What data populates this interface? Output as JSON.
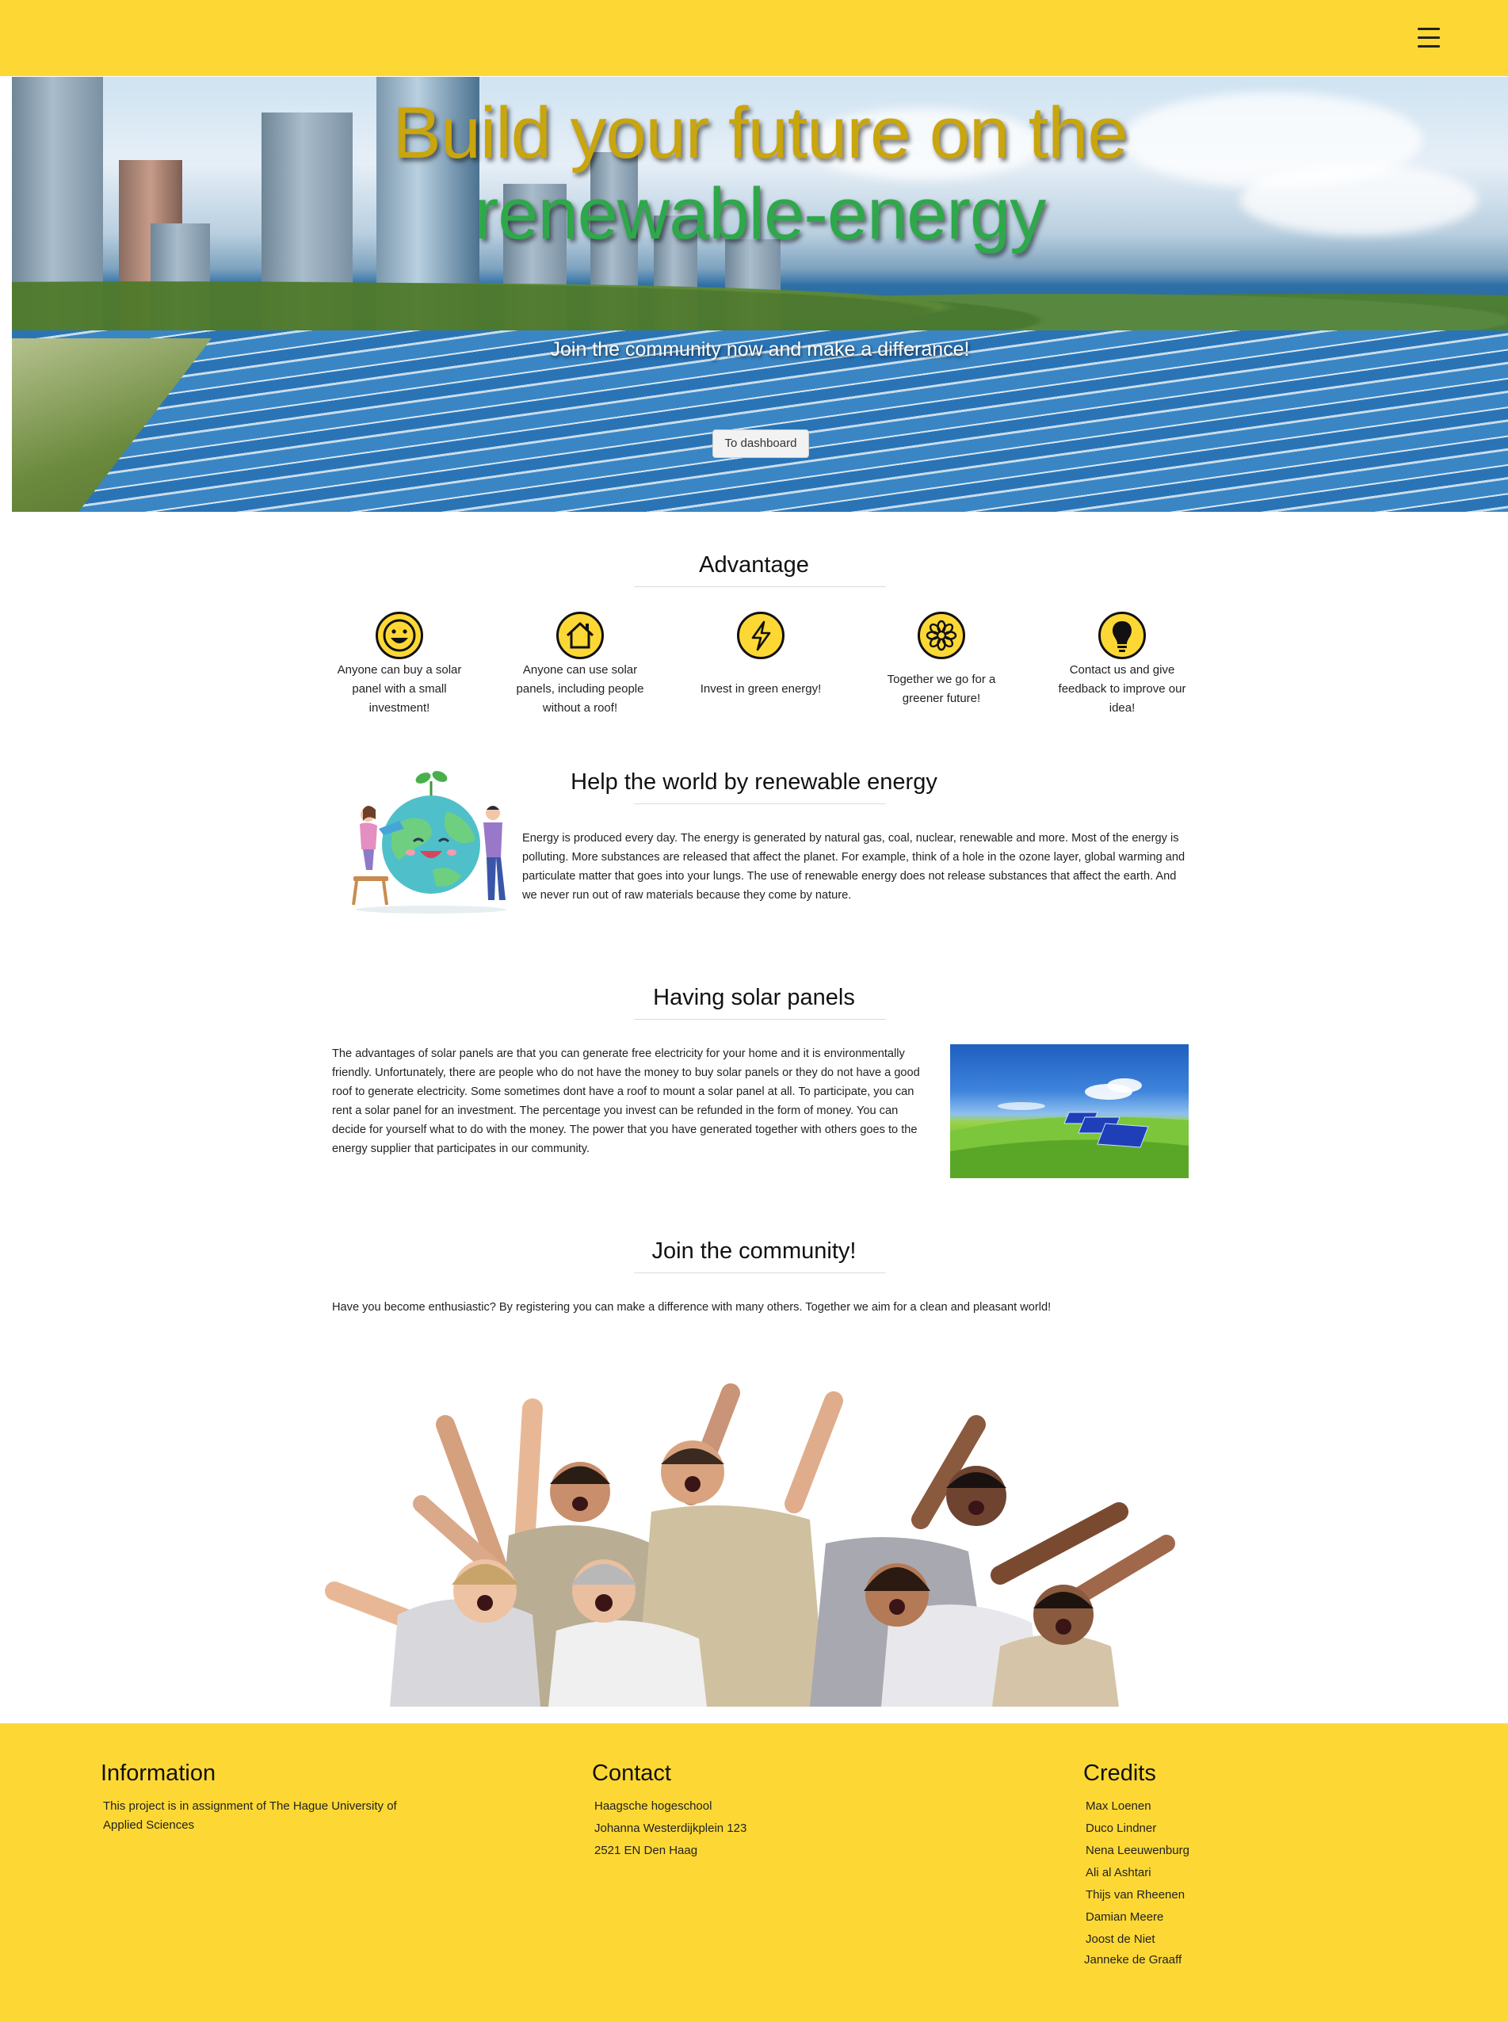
{
  "hero": {
    "title_line1": "Build your future on the",
    "title_line2": "renewable-energy",
    "subtitle": "Join the community now and make a differance!",
    "button": "To dashboard"
  },
  "advantage": {
    "title": "Advantage",
    "items": [
      {
        "icon": "smile-icon",
        "text": "Anyone can buy a solar panel with a small investment!"
      },
      {
        "icon": "house-icon",
        "text": "Anyone can use solar panels, including people without a roof!"
      },
      {
        "icon": "lightning-icon",
        "text": "Invest in green energy!"
      },
      {
        "icon": "flower-icon",
        "text": "Together we go for a greener future!"
      },
      {
        "icon": "lightbulb-icon",
        "text": "Contact us and give feedback to improve our idea!"
      }
    ]
  },
  "help": {
    "title": "Help the world by renewable energy",
    "text": "Energy is produced every day. The energy is generated by natural gas, coal, nuclear, renewable and more. Most of the energy is polluting. More substances are released that affect the planet. For example, think of a hole in the ozone layer, global warming and particulate matter that goes into your lungs. The use of renewable energy does not release substances that affect the earth. And we never run out of raw materials because they come by nature."
  },
  "solar": {
    "title": "Having solar panels",
    "text": "The advantages of solar panels are that you can generate free electricity for your home and it is environmentally friendly. Unfortunately, there are people who do not have the money to buy solar panels or they do not have a good roof to generate electricity. Some sometimes dont have a roof to mount a solar panel at all. To participate, you can rent a solar panel for an investment. The percentage you invest can be refunded in the form of money. You can decide for yourself what to do with the money. The power that you have generated together with others goes to the energy supplier that participates in our community."
  },
  "join": {
    "title": "Join the community!",
    "text": "Have you become enthusiastic? By registering you can make a difference with many others. Together we aim for a clean and pleasant world!"
  },
  "footer": {
    "information": {
      "title": "Information",
      "text": [
        "This project is in assignment of The Hague University of",
        "Applied Sciences"
      ]
    },
    "contact": {
      "title": "Contact",
      "lines": [
        "Haagsche hogeschool",
        "Johanna Westerdijkplein 123",
        "2521 EN Den Haag"
      ]
    },
    "credits": {
      "title": "Credits",
      "names": [
        "Max Loenen",
        "Duco Lindner",
        "Nena Leeuwenburg",
        "Ali al Ashtari",
        "Thijs van Rheenen",
        "Damian Meere",
        "Joost de Niet",
        "Janneke de Graaff"
      ]
    }
  },
  "colors": {
    "brand_yellow": "#fdd835",
    "title_gold": "#c9a50e",
    "title_green": "#2ea84a"
  }
}
